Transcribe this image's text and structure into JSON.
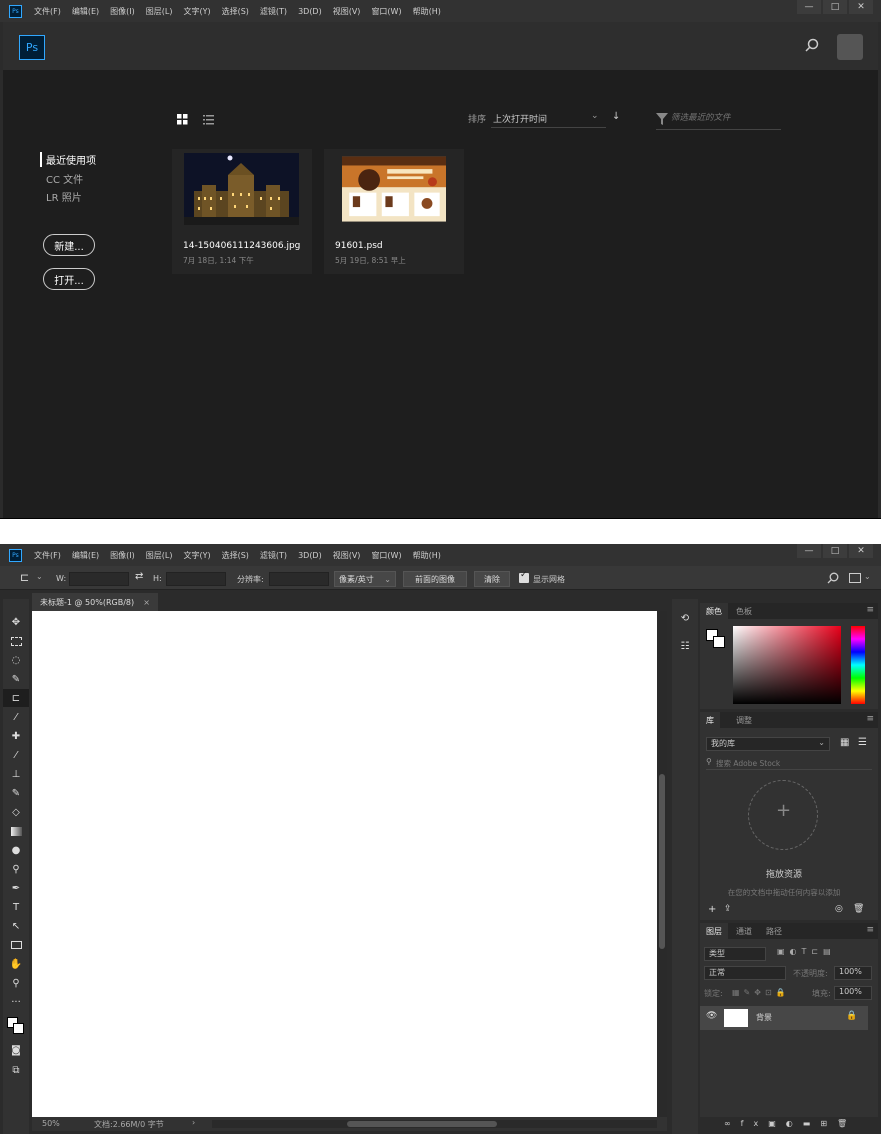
{
  "menu": [
    "文件(F)",
    "编辑(E)",
    "图像(I)",
    "图层(L)",
    "文字(Y)",
    "选择(S)",
    "滤镜(T)",
    "3D(D)",
    "视图(V)",
    "窗口(W)",
    "帮助(H)"
  ],
  "app_logo": "Ps",
  "window_controls": [
    "—",
    "□",
    "✕"
  ],
  "home": {
    "sidebar": {
      "items": [
        "最近使用项",
        "CC 文件",
        "LR 照片"
      ],
      "new_button": "新建...",
      "open_button": "打开..."
    },
    "sort_label": "排序",
    "sort_value": "上次打开时间",
    "filter_placeholder": "筛选最近的文件",
    "recent_files": [
      {
        "name": "14-150406111243606.jpg",
        "date": "7月 18日, 1:14 下午"
      },
      {
        "name": "91601.psd",
        "date": "5月 19日, 8:51 早上"
      }
    ]
  },
  "editor": {
    "options": {
      "w_label": "W:",
      "h_label": "H:",
      "resolution_label": "分辨率:",
      "unit_select": "像素/英寸",
      "front_image_button": "前面的图像",
      "clear_button": "清除",
      "show_grid_label": "显示网格"
    },
    "doc_tab": "未标题-1 @ 50%(RGB/8)",
    "doc_tab_close": "×",
    "status_zoom": "50%",
    "status_doc": "文档:2.66M/0 字节",
    "color_panel": {
      "tabs": [
        "颜色",
        "色板"
      ]
    },
    "library_panel": {
      "tabs": [
        "库",
        "调整"
      ],
      "library_select": "我的库",
      "search_placeholder": "搜索 Adobe Stock",
      "drop_title": "拖放资源",
      "drop_hint": "在您的文档中拖动任何内容以添加"
    },
    "layers_panel": {
      "tabs": [
        "图层",
        "通道",
        "路径"
      ],
      "filter_type": "类型",
      "blend_mode": "正常",
      "opacity_label": "不透明度:",
      "opacity_value": "100%",
      "lock_label": "锁定:",
      "fill_label": "填充:",
      "fill_value": "100%",
      "layer_name": "背景"
    }
  },
  "colors": {
    "accent": "#31a8ff",
    "foreground_swatch": "#ffffff"
  }
}
